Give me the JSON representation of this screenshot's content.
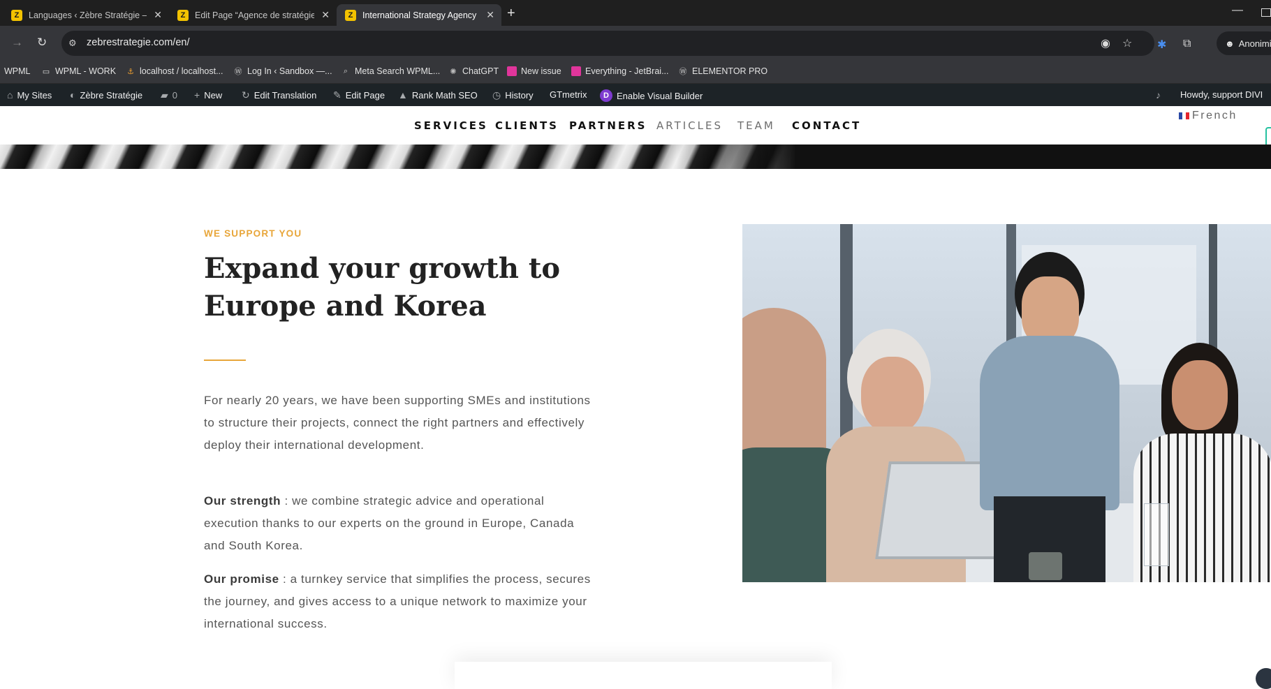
{
  "browser": {
    "tabs": [
      {
        "title": "Languages ‹ Zèbre Stratégie —",
        "active": false
      },
      {
        "title": "Edit Page “Agence de stratégie",
        "active": false
      },
      {
        "title": "International Strategy Agency -",
        "active": true
      }
    ],
    "url": "zebrestrategie.com/en/",
    "profile_label": "Anonimi"
  },
  "bookmarks": [
    {
      "label": "WPML",
      "icon": "none"
    },
    {
      "label": "WPML - WORK",
      "icon": "folder-icon"
    },
    {
      "label": "localhost / localhost...",
      "icon": "phpmyadmin-icon"
    },
    {
      "label": "Log In ‹ Sandbox —...",
      "icon": "wordpress-icon"
    },
    {
      "label": "Meta Search WPML...",
      "icon": "search-icon"
    },
    {
      "label": "ChatGPT",
      "icon": "chatgpt-icon"
    },
    {
      "label": "New issue",
      "icon": "jetbrains-icon"
    },
    {
      "label": "Everything - JetBrai...",
      "icon": "jetbrains-icon"
    },
    {
      "label": "ELEMENTOR PRO",
      "icon": "wordpress-icon"
    }
  ],
  "admin_bar": {
    "my_sites": "My Sites",
    "site_name": "Zèbre Stratégie",
    "comments_count": "0",
    "new": "New",
    "edit_translation": "Edit Translation",
    "edit_page": "Edit Page",
    "rank_math": "Rank Math SEO",
    "history": "History",
    "gtmetrix": "GTmetrix",
    "visual_builder": "Enable Visual Builder",
    "howdy": "Howdy, support DIVI"
  },
  "nav": {
    "items": [
      "SERVICES",
      "CLIENTS",
      "PARTNERS",
      "ARTICLES",
      "TEAM",
      "CONTACT"
    ],
    "language": "French"
  },
  "content": {
    "eyebrow": "WE SUPPORT YOU",
    "headline_line1": "Expand your growth to",
    "headline_line2": "Europe and Korea",
    "para1": "For nearly 20 years, we have been supporting SMEs and institutions to structure their projects, connect the right partners and effectively deploy their international development.",
    "para2_bold": "Our strength",
    "para2_rest": " : we combine strategic advice and operational execution thanks to our experts on the ground in Europe, Canada and South Korea.",
    "para3_bold": "Our promise",
    "para3_rest": " : a turnkey service that simplifies the process, secures the journey, and gives access to a unique network to maximize your international success."
  },
  "colors": {
    "accent": "#e8a63a",
    "admin_bar": "#1d2327",
    "browser_chrome": "#35363a"
  }
}
